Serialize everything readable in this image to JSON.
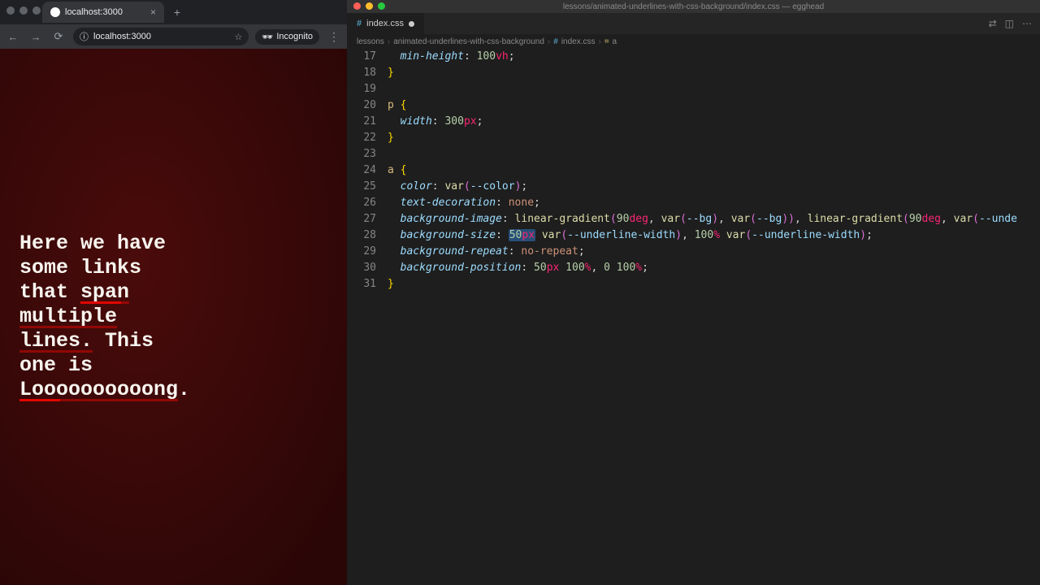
{
  "browser": {
    "tab": {
      "title": "localhost:3000"
    },
    "url": "localhost:3000",
    "incognito_label": "Incognito",
    "page": {
      "text_1": "Here we have some links that ",
      "link_1": "span multiple lines.",
      "text_2": " This one is ",
      "link_2": "Loooooooooong",
      "text_3": "."
    }
  },
  "editor": {
    "window_title": "lessons/animated-underlines-with-css-background/index.css — egghead",
    "tab_name": "index.css",
    "breadcrumb": {
      "seg1": "lessons",
      "seg2": "animated-underlines-with-css-background",
      "seg3": "index.css",
      "seg4": "a"
    },
    "lines": {
      "start": 17,
      "l17": {
        "prop": "min-height",
        "num": "100",
        "unit": "vh"
      },
      "l20": {
        "sel": "p"
      },
      "l21": {
        "prop": "width",
        "num": "300",
        "unit": "px"
      },
      "l24": {
        "sel": "a"
      },
      "l25": {
        "prop": "color",
        "func": "var",
        "var": "--color"
      },
      "l26": {
        "prop": "text-decoration",
        "val": "none"
      },
      "l27": {
        "prop": "background-image",
        "func": "linear-gradient",
        "deg": "90",
        "degu": "deg",
        "var1": "--bg",
        "var2": "--bg",
        "var3": "--unde"
      },
      "l28": {
        "prop": "background-size",
        "sel_num": "50",
        "sel_unit": "px",
        "var1": "--underline-width",
        "n2": "100",
        "u2": "%",
        "var2": "--underline-width"
      },
      "l29": {
        "prop": "background-repeat",
        "val": "no-repeat"
      },
      "l30": {
        "prop": "background-position",
        "n1": "50",
        "u1": "px",
        "n2": "100",
        "u2": "%",
        "n3": "0",
        "n4": "100",
        "u4": "%"
      }
    }
  }
}
